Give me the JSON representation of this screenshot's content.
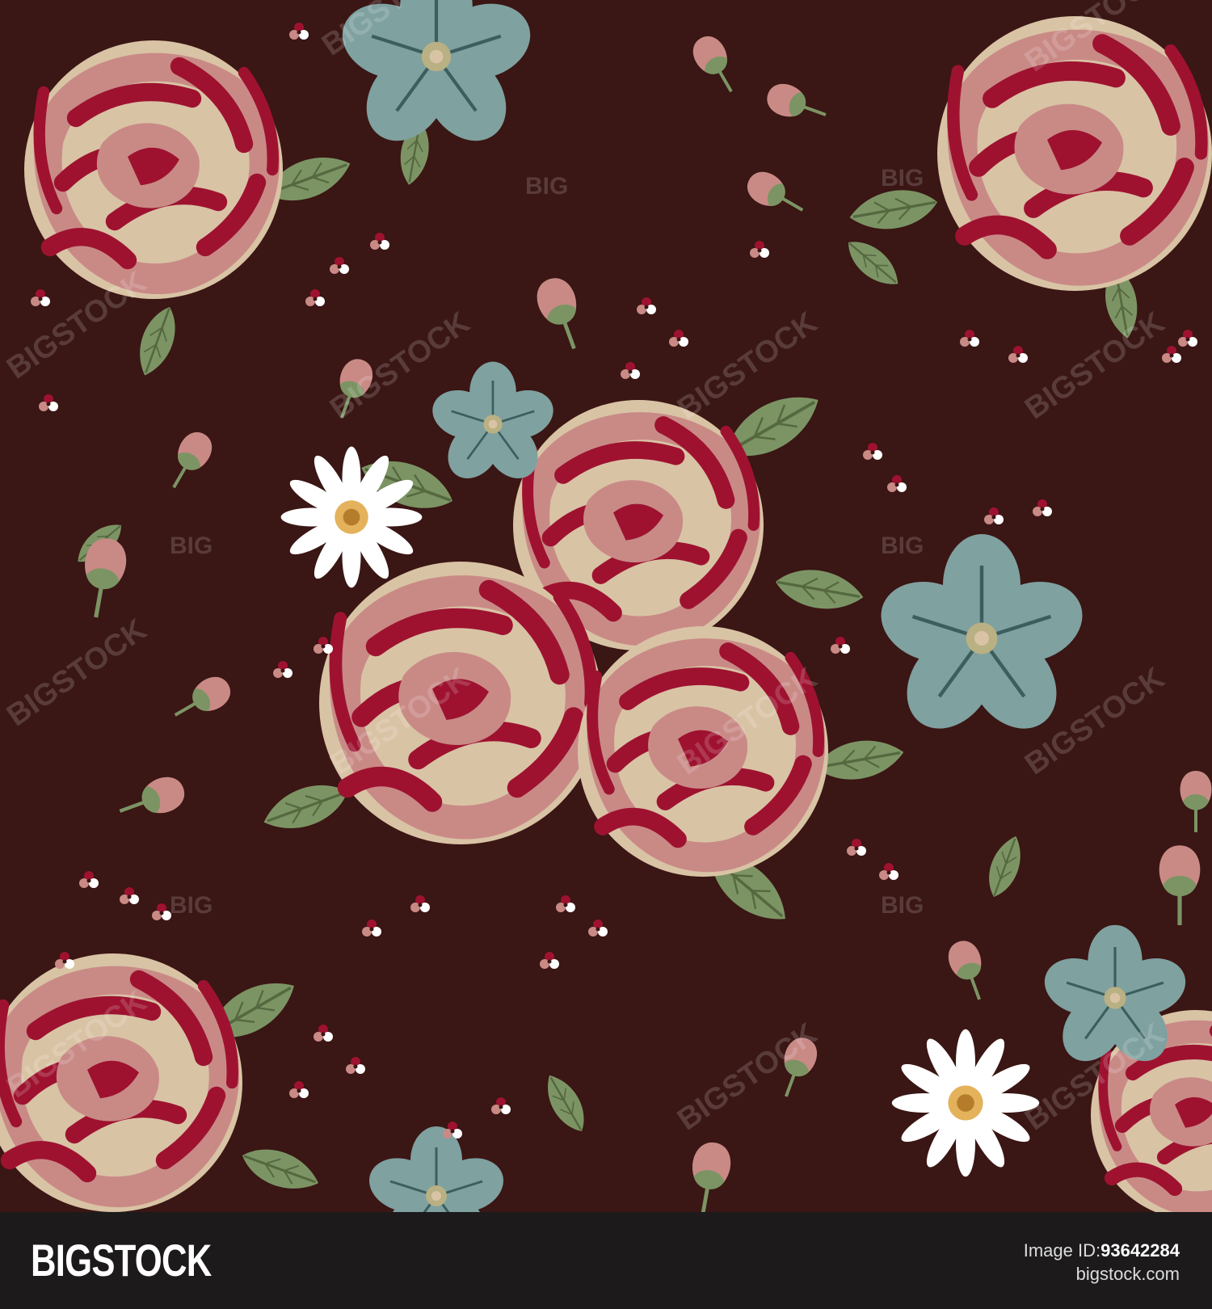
{
  "footer": {
    "brand": "BIGSTOCK",
    "image_id_label": "Image ID:",
    "image_id": "93642284",
    "site": "bigstock.com"
  },
  "watermark": {
    "big": "BIG",
    "long": "BIGSTOCK"
  },
  "palette": {
    "background": "#3a1614",
    "rose_cream": "#d9c3a5",
    "rose_pink": "#c98a86",
    "rose_red": "#9e1230",
    "leaf_green": "#7c9464",
    "leaf_dark": "#5e7447",
    "blue_petal": "#7fa1a0",
    "daisy_white": "#ffffff",
    "daisy_center": "#e3b25a",
    "footer": "#1c1a1b"
  }
}
